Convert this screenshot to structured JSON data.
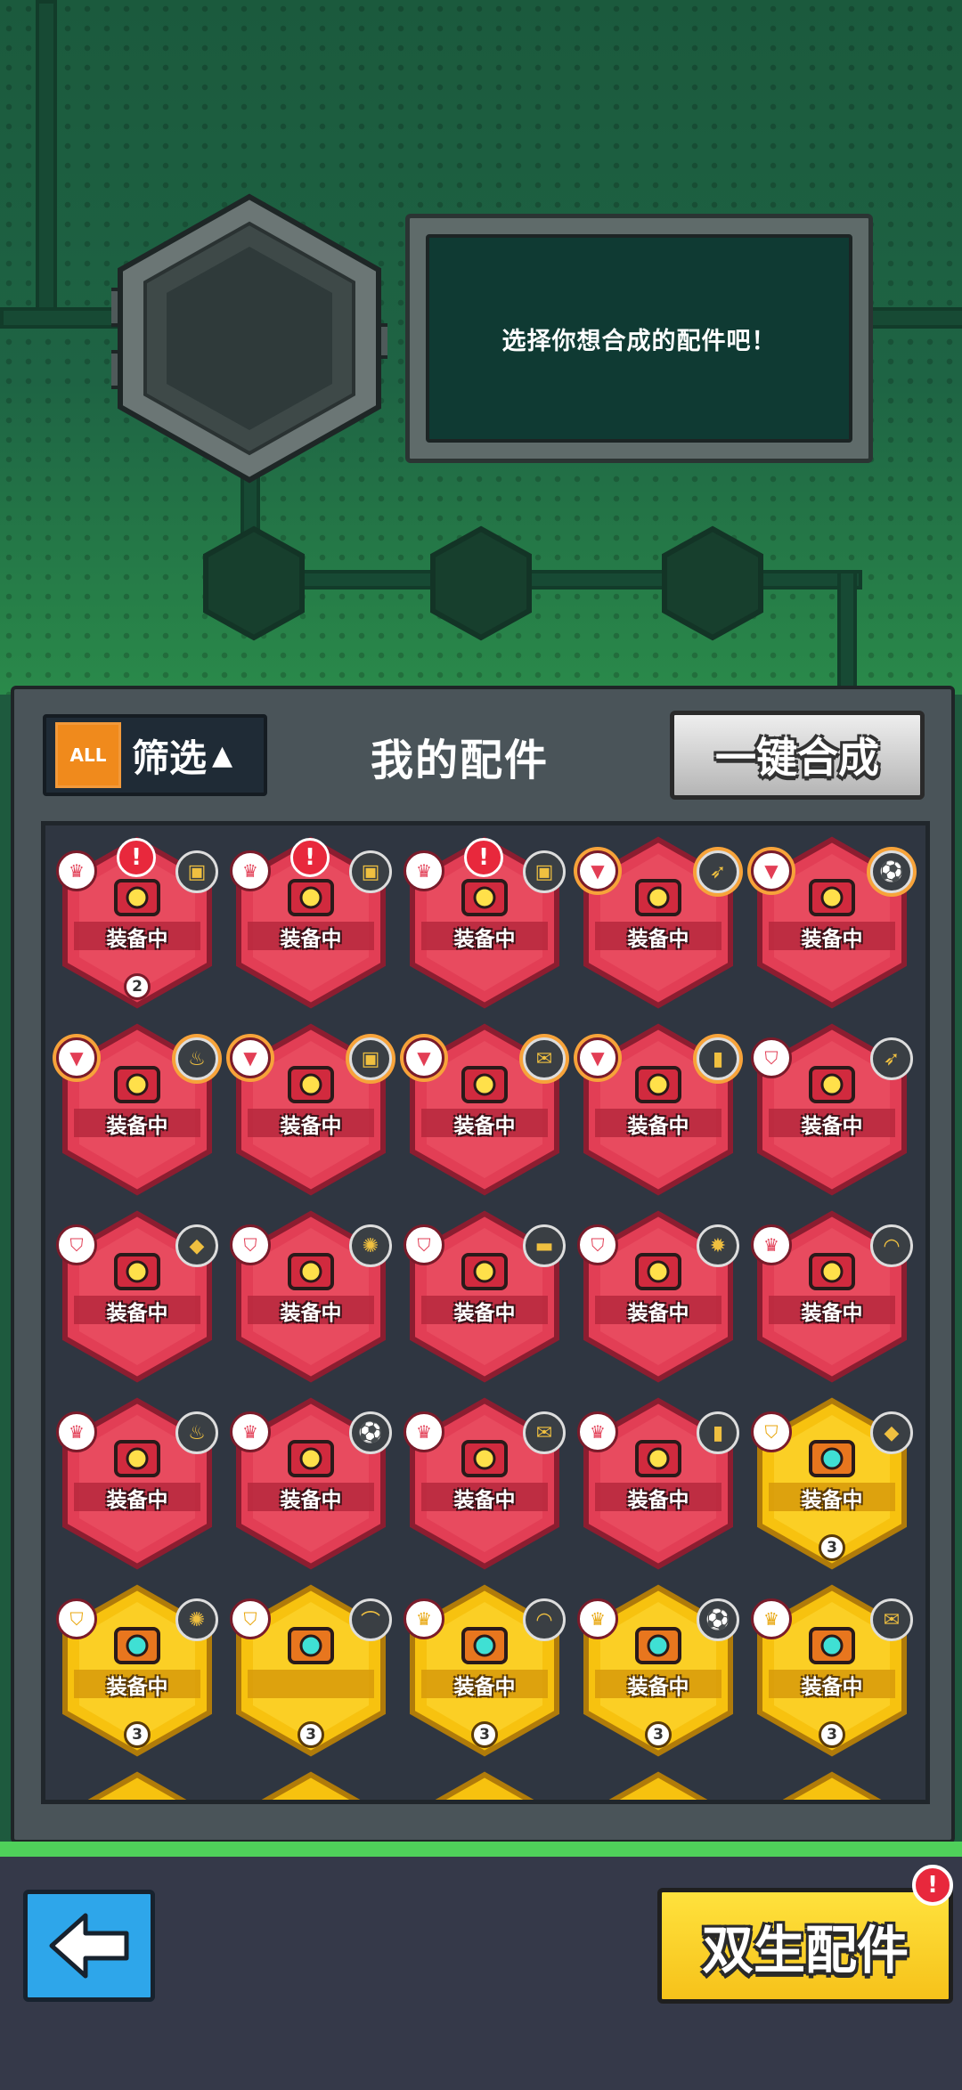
{
  "slot": {
    "prompt": "选择你想合成的配件吧！"
  },
  "panel": {
    "filter_badge": "ALL",
    "filter_label": "筛选",
    "filter_arrow": "▲",
    "title": "我的配件",
    "merge_button": "一键合成"
  },
  "cards": [
    {
      "tier": "red",
      "status": "装备中",
      "rank_icon": "crown",
      "item_icon": "cannon",
      "alert": "!",
      "count": "2",
      "glow": false
    },
    {
      "tier": "red",
      "status": "装备中",
      "rank_icon": "crown",
      "item_icon": "cannon",
      "alert": "!",
      "glow": false
    },
    {
      "tier": "red",
      "status": "装备中",
      "rank_icon": "crown",
      "item_icon": "cannon",
      "alert": "!",
      "glow": false
    },
    {
      "tier": "red",
      "status": "装备中",
      "rank_icon": "tri-gem",
      "item_icon": "rocket",
      "glow": true
    },
    {
      "tier": "red",
      "status": "装备中",
      "rank_icon": "tri-gem",
      "item_icon": "soccer-ball",
      "glow": true
    },
    {
      "tier": "red",
      "status": "装备中",
      "rank_icon": "tri-gem",
      "item_icon": "coil",
      "glow": true
    },
    {
      "tier": "red",
      "status": "装备中",
      "rank_icon": "tri-gem",
      "item_icon": "cannon",
      "glow": true
    },
    {
      "tier": "red",
      "status": "装备中",
      "rank_icon": "tri-gem",
      "item_icon": "stamp",
      "glow": true
    },
    {
      "tier": "red",
      "status": "装备中",
      "rank_icon": "tri-gem",
      "item_icon": "bottle",
      "glow": true
    },
    {
      "tier": "red",
      "status": "装备中",
      "rank_icon": "shield",
      "item_icon": "rocket",
      "glow": false
    },
    {
      "tier": "red",
      "status": "装备中",
      "rank_icon": "shield",
      "item_icon": "gem-green",
      "glow": false
    },
    {
      "tier": "red",
      "status": "装备中",
      "rank_icon": "shield",
      "item_icon": "saw",
      "glow": false
    },
    {
      "tier": "red",
      "status": "装备中",
      "rank_icon": "shield",
      "item_icon": "brick",
      "glow": false
    },
    {
      "tier": "red",
      "status": "装备中",
      "rank_icon": "shield",
      "item_icon": "virus",
      "glow": false
    },
    {
      "tier": "red",
      "status": "装备中",
      "rank_icon": "crown",
      "item_icon": "croissant",
      "glow": false
    },
    {
      "tier": "red",
      "status": "装备中",
      "rank_icon": "crown",
      "item_icon": "coil",
      "glow": false
    },
    {
      "tier": "red",
      "status": "装备中",
      "rank_icon": "crown",
      "item_icon": "soccer-ball",
      "glow": false
    },
    {
      "tier": "red",
      "status": "装备中",
      "rank_icon": "crown",
      "item_icon": "stamp",
      "glow": false
    },
    {
      "tier": "red",
      "status": "装备中",
      "rank_icon": "crown",
      "item_icon": "bottle",
      "glow": false
    },
    {
      "tier": "gold",
      "status": "装备中",
      "rank_icon": "shield",
      "item_icon": "gem-green",
      "count": "3",
      "glow": false
    },
    {
      "tier": "gold",
      "status": "装备中",
      "rank_icon": "shield",
      "item_icon": "saw",
      "count": "3",
      "glow": false
    },
    {
      "tier": "gold",
      "status": "",
      "rank_icon": "shield",
      "item_icon": "boomerang",
      "count": "3",
      "glow": false
    },
    {
      "tier": "gold",
      "status": "装备中",
      "rank_icon": "crown",
      "item_icon": "croissant",
      "count": "3",
      "glow": false
    },
    {
      "tier": "gold",
      "status": "装备中",
      "rank_icon": "crown",
      "item_icon": "soccer-ball",
      "count": "3",
      "glow": false
    },
    {
      "tier": "gold",
      "status": "装备中",
      "rank_icon": "crown",
      "item_icon": "stamp",
      "count": "3",
      "glow": false
    }
  ],
  "bottom": {
    "back_icon": "arrow-left-icon",
    "twin_button": "双生配件",
    "twin_alert": "!"
  }
}
